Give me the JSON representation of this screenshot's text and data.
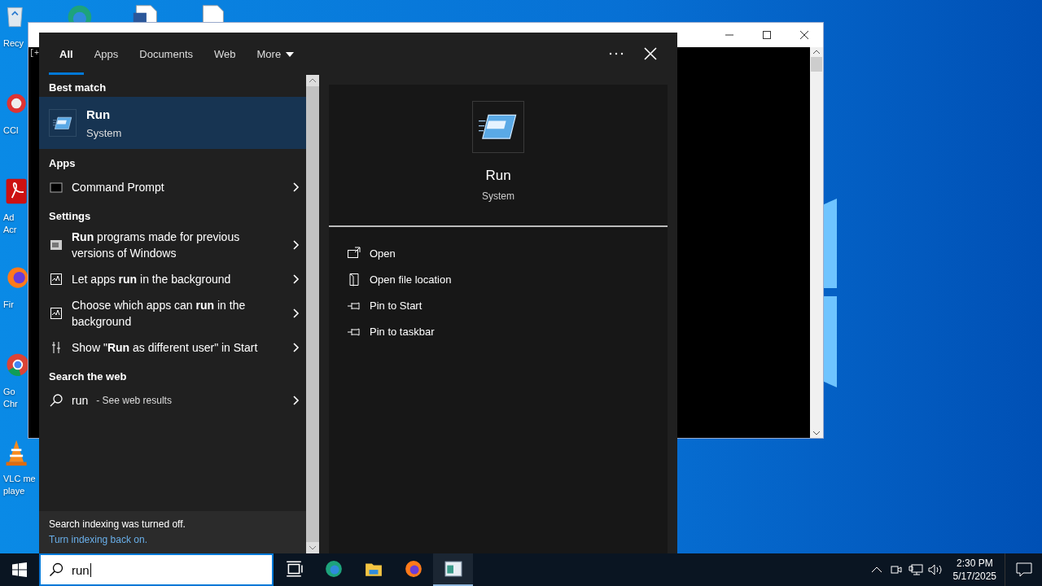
{
  "desktop": {
    "icons": [
      {
        "kind": "recycle-bin",
        "lines": [
          "Recy"
        ]
      },
      {
        "kind": "ccleaner",
        "lines": [
          "CCl"
        ]
      },
      {
        "kind": "acrobat",
        "lines": [
          "Ad",
          "Acr"
        ]
      },
      {
        "kind": "firefox",
        "lines": [
          "Fir"
        ]
      },
      {
        "kind": "chrome",
        "lines": [
          "Go",
          "Chr"
        ]
      },
      {
        "kind": "vlc",
        "lines": [
          "VLC me",
          "playe"
        ]
      }
    ],
    "top_icons": [
      {
        "kind": "edge"
      },
      {
        "kind": "word"
      },
      {
        "kind": "document"
      }
    ]
  },
  "console_window": {
    "text": "[+"
  },
  "search_panel": {
    "tabs": [
      {
        "label": "All",
        "selected": true,
        "kind": "tab"
      },
      {
        "label": "Apps",
        "selected": false,
        "kind": "tab"
      },
      {
        "label": "Documents",
        "selected": false,
        "kind": "tab"
      },
      {
        "label": "Web",
        "selected": false,
        "kind": "tab"
      },
      {
        "label": "More",
        "selected": false,
        "kind": "menu"
      }
    ],
    "best_match": {
      "heading": "Best match",
      "title": "Run",
      "subtitle": "System",
      "selected": true
    },
    "sections": [
      {
        "heading": "Apps",
        "items": [
          {
            "kind": "app",
            "text": "Command Prompt"
          }
        ]
      },
      {
        "heading": "Settings",
        "items": [
          {
            "kind": "compat",
            "text": "**Run** programs made for previous versions of Windows"
          },
          {
            "kind": "background",
            "text": "Let apps **run** in the background"
          },
          {
            "kind": "background",
            "text": "Choose which apps can **run** in the background"
          },
          {
            "kind": "user",
            "text": "Show \"**Run** as different user\" in Start"
          }
        ]
      },
      {
        "heading": "Search the web",
        "items": [
          {
            "kind": "web",
            "text": "run",
            "hint": "- See web results"
          }
        ]
      }
    ],
    "notice": {
      "text": "Search indexing was turned off.",
      "link": "Turn indexing back on."
    },
    "detail": {
      "title": "Run",
      "subtitle": "System",
      "actions": [
        {
          "kind": "open",
          "label": "Open"
        },
        {
          "kind": "folder",
          "label": "Open file location"
        },
        {
          "kind": "pin",
          "label": "Pin to Start"
        },
        {
          "kind": "pin",
          "label": "Pin to taskbar"
        }
      ]
    }
  },
  "taskbar": {
    "search_value": "run",
    "apps": [
      {
        "kind": "task-view",
        "running": false
      },
      {
        "kind": "edge",
        "running": false
      },
      {
        "kind": "explorer",
        "running": false
      },
      {
        "kind": "firefox",
        "running": false
      },
      {
        "kind": "window",
        "running": true
      }
    ],
    "time": "2:30 PM",
    "date": "5/17/2025"
  }
}
